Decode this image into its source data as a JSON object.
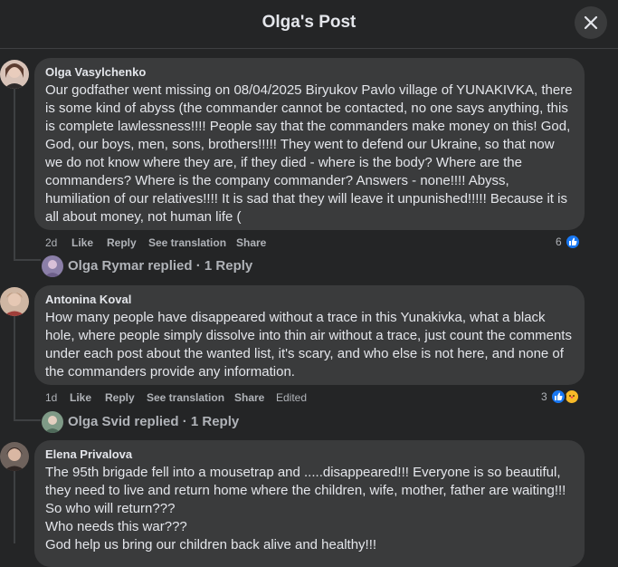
{
  "header": {
    "title": "Olga's Post"
  },
  "comments": [
    {
      "author": "Olga Vasylchenko",
      "text": "Our godfather went missing on 08/04/2025 Biryukov Pavlo village of YUNAKIVKA, there is some kind of abyss (the commander cannot be contacted, no one says anything, this is complete lawlessness!!!! People say that the commanders make money on this! God, God, our boys, men, sons, brothers!!!!! They went to defend our Ukraine, so that now we do not know where they are, if they died - where is the body? Where are the commanders? Where is the company commander? Answers - none!!!! Abyss, humiliation of our relatives!!!! It is sad that they will leave it unpunished!!!!! Because it is all about money, not human life (",
      "time": "2d",
      "like": "Like",
      "reply": "Reply",
      "translate": "See translation",
      "share": "Share",
      "reaction_count": "6",
      "replies_text": "Olga Rymar replied · 1 Reply",
      "avatar_color": "#c9a99a"
    },
    {
      "author": "Antonina Koval",
      "text": "How many people have disappeared without a trace in this Yunakivka, what a black hole, where people simply dissolve into thin air without a trace, just count the comments under each post about the wanted list, it's scary, and who else is not here, and none of the commanders provide any information.",
      "time": "1d",
      "like": "Like",
      "reply": "Reply",
      "translate": "See translation",
      "share": "Share",
      "edited": "Edited",
      "reaction_count": "3",
      "replies_text": "Olga Svid replied · 1 Reply",
      "avatar_color": "#b07e6a"
    },
    {
      "author": "Elena Privalova",
      "text_lines": [
        "The 95th brigade fell into a mousetrap and .....disappeared!!! Everyone is so beautiful,",
        "they need to live and return home where the children, wife, mother, father are waiting!!!",
        "So who will return???",
        "Who needs this war???",
        "God help us bring our children back alive and healthy!!!"
      ],
      "avatar_color": "#7d6b66"
    }
  ],
  "colors": {
    "background": "#242526",
    "bubble": "#3a3b3c",
    "like_blue": "#1877f2",
    "muted_text": "#b0b3b8"
  }
}
